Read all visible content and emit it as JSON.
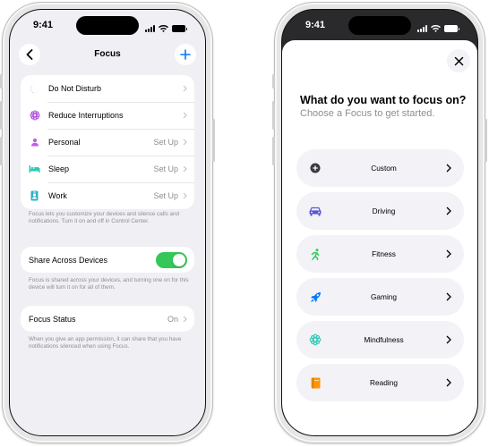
{
  "left_phone": {
    "status_time": "9:41",
    "nav": {
      "title": "Focus"
    },
    "focus_modes": [
      {
        "label": "Do Not Disturb",
        "value": "",
        "icon": "moon-icon",
        "color": "#5e5ce6"
      },
      {
        "label": "Reduce Interruptions",
        "value": "",
        "icon": "flower-icon",
        "color": "#af52de"
      },
      {
        "label": "Personal",
        "value": "Set Up",
        "icon": "person-icon",
        "color": "#bf5af2"
      },
      {
        "label": "Sleep",
        "value": "Set Up",
        "icon": "bed-icon",
        "color": "#30c8b6"
      },
      {
        "label": "Work",
        "value": "Set Up",
        "icon": "id-badge-icon",
        "color": "#30b0c7"
      }
    ],
    "focus_note": "Focus lets you customize your devices and silence calls and notifications. Turn it on and off in Control Center.",
    "share_across_devices": {
      "label": "Share Across Devices",
      "enabled": true
    },
    "share_note": "Focus is shared across your devices, and turning one on for this device will turn it on for all of them.",
    "focus_status": {
      "label": "Focus Status",
      "value": "On"
    },
    "status_note": "When you give an app permission, it can share that you have notifications silenced when using Focus."
  },
  "right_phone": {
    "status_time": "9:41",
    "title": "What do you want to focus on?",
    "subtitle": "Choose a Focus to get started.",
    "options": [
      {
        "label": "Custom",
        "icon": "plus-circle-icon",
        "color": "#3a3a3c"
      },
      {
        "label": "Driving",
        "icon": "car-icon",
        "color": "#5856d6"
      },
      {
        "label": "Fitness",
        "icon": "running-icon",
        "color": "#34c759"
      },
      {
        "label": "Gaming",
        "icon": "rocket-icon",
        "color": "#007aff"
      },
      {
        "label": "Mindfulness",
        "icon": "flower-icon",
        "color": "#30c8b6"
      },
      {
        "label": "Reading",
        "icon": "book-icon",
        "color": "#ff9500"
      }
    ]
  },
  "colors": {
    "accent": "#007aff",
    "toggle_on": "#34c759",
    "background": "#efeff4",
    "secondary_text": "#8e8e93"
  }
}
